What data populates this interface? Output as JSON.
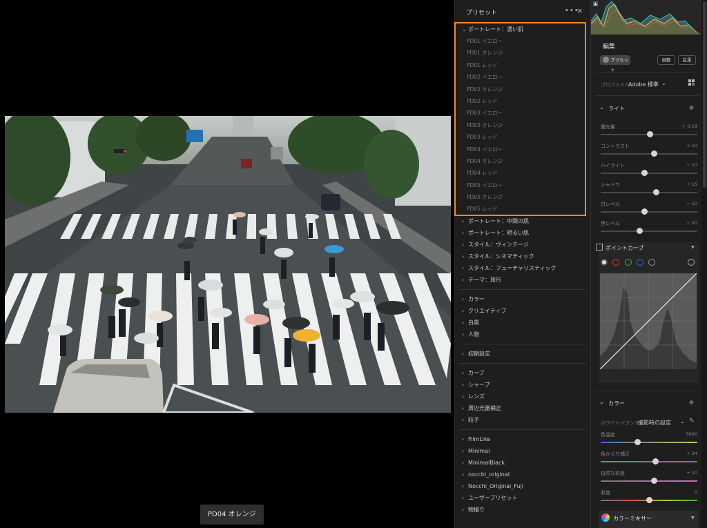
{
  "viewer": {
    "preview_label": "PD04 オレンジ"
  },
  "preset_panel": {
    "title": "プリセット",
    "more_icon": "•••",
    "close_icon": "×",
    "expanded_group": "ポートレート：濃い肌",
    "expanded_items": [
      "PD01 イエロー",
      "PD01 オレンジ",
      "PD01 レッド",
      "PD02 イエロー",
      "PD02 オレンジ",
      "PD02 レッド",
      "PD03 イエロー",
      "PD03 オレンジ",
      "PD03 レッド",
      "PD04 イエロー",
      "PD04 オレンジ",
      "PD04 レッド",
      "PD05 イエロー",
      "PD05 オレンジ",
      "PD05 レッド"
    ],
    "group_blocks": [
      [
        "ポートレート：中間の肌",
        "ポートレート：明るい肌",
        "スタイル：ヴィンテージ",
        "スタイル：シネマティック",
        "スタイル：フューチャリスティック",
        "テーマ：旅行"
      ],
      [
        "カラー",
        "クリエイティブ",
        "白黒",
        "人物"
      ],
      [
        "初期設定"
      ],
      [
        "カーブ",
        "シャープ",
        "レンズ",
        "周辺光量補正",
        "粒子"
      ],
      [
        "FilmLike",
        "Minimal",
        "MinimalBlack",
        "nocchi_original",
        "Nocchi_Original_Fuji",
        "ユーザープリセット",
        "物撮り"
      ]
    ],
    "highlight_color": "#ee8a2e"
  },
  "edit_panel": {
    "title": "編集",
    "preset_button": "プリセット",
    "auto_button": "自動",
    "bw_button": "白黒",
    "profile_label": "プロファイル",
    "profile_value": "Adobe 標準",
    "light_section": "ライト",
    "light_sliders": [
      {
        "label": "露光量",
        "value": "+ 0.19",
        "level": 0.51
      },
      {
        "label": "コントラスト",
        "value": "+ 10",
        "level": 0.55
      },
      {
        "label": "ハイライト",
        "value": "− 10",
        "level": 0.45
      },
      {
        "label": "シャドウ",
        "value": "+ 15",
        "level": 0.575
      },
      {
        "label": "白レベル",
        "value": "− 10",
        "level": 0.45
      },
      {
        "label": "黒レベル",
        "value": "− 20",
        "level": 0.4
      }
    ],
    "curve_section": "ポイントカーブ",
    "color_section": "カラー",
    "wb_label": "ホワイトバランス",
    "wb_value": "撮影時の設定",
    "color_sliders": [
      {
        "label": "色温度",
        "value": "5600",
        "level": 0.38
      },
      {
        "label": "色かぶり補正",
        "value": "+ 24",
        "level": 0.57
      },
      {
        "label": "自然な彩度",
        "value": "+ 10",
        "level": 0.55
      },
      {
        "label": "彩度",
        "value": "0",
        "level": 0.5
      }
    ],
    "mixer_section": "カラーミキサー"
  }
}
